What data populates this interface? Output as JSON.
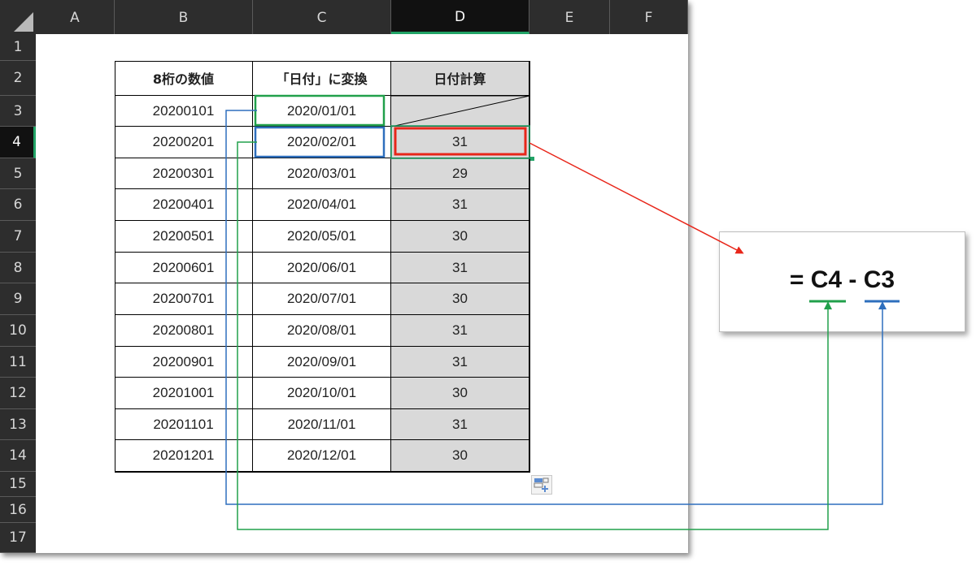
{
  "spreadsheet": {
    "columns": [
      "A",
      "B",
      "C",
      "D",
      "E",
      "F"
    ],
    "active_column": "D",
    "rows": [
      "1",
      "2",
      "3",
      "4",
      "5",
      "6",
      "7",
      "8",
      "9",
      "10",
      "11",
      "12",
      "13",
      "14",
      "15",
      "16",
      "17"
    ],
    "active_row": "4",
    "table_headers": [
      "8桁の数値",
      "「日付」に変換",
      "日付計算"
    ],
    "table_rows": [
      {
        "number": "20200101",
        "date": "2020/01/01",
        "diff": ""
      },
      {
        "number": "20200201",
        "date": "2020/02/01",
        "diff": "31"
      },
      {
        "number": "20200301",
        "date": "2020/03/01",
        "diff": "29"
      },
      {
        "number": "20200401",
        "date": "2020/04/01",
        "diff": "31"
      },
      {
        "number": "20200501",
        "date": "2020/05/01",
        "diff": "30"
      },
      {
        "number": "20200601",
        "date": "2020/06/01",
        "diff": "31"
      },
      {
        "number": "20200701",
        "date": "2020/07/01",
        "diff": "30"
      },
      {
        "number": "20200801",
        "date": "2020/08/01",
        "diff": "31"
      },
      {
        "number": "20200901",
        "date": "2020/09/01",
        "diff": "31"
      },
      {
        "number": "20201001",
        "date": "2020/10/01",
        "diff": "30"
      },
      {
        "number": "20201101",
        "date": "2020/11/01",
        "diff": "31"
      },
      {
        "number": "20201201",
        "date": "2020/12/01",
        "diff": "30"
      }
    ]
  },
  "formula": {
    "text": "= C4 - C3",
    "ref_first": "C4",
    "ref_second": "C3"
  },
  "colors": {
    "green_ref": "#21a04b",
    "blue_ref": "#2e6fbd",
    "red_highlight": "#e8261a",
    "selection_green": "#21a366",
    "header_bg": "#2d2d2d",
    "gray_cell": "#d9d9d9"
  },
  "icons": {
    "quick_analysis": "quick-analysis-icon"
  }
}
